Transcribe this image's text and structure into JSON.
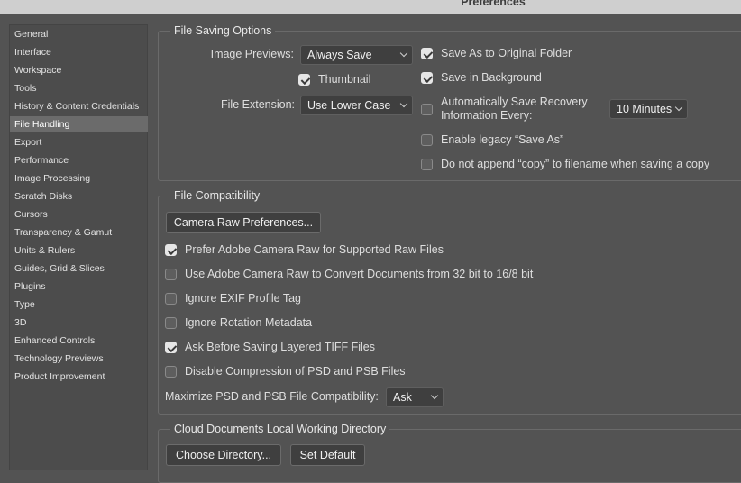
{
  "window": {
    "title": "Preferences"
  },
  "sidebar": {
    "items": [
      {
        "label": "General"
      },
      {
        "label": "Interface"
      },
      {
        "label": "Workspace"
      },
      {
        "label": "Tools"
      },
      {
        "label": "History & Content Credentials"
      },
      {
        "label": "File Handling",
        "selected": true
      },
      {
        "label": "Export"
      },
      {
        "label": "Performance"
      },
      {
        "label": "Image Processing"
      },
      {
        "label": "Scratch Disks"
      },
      {
        "label": "Cursors"
      },
      {
        "label": "Transparency & Gamut"
      },
      {
        "label": "Units & Rulers"
      },
      {
        "label": "Guides, Grid & Slices"
      },
      {
        "label": "Plugins"
      },
      {
        "label": "Type"
      },
      {
        "label": "3D"
      },
      {
        "label": "Enhanced Controls"
      },
      {
        "label": "Technology Previews"
      },
      {
        "label": "Product Improvement"
      }
    ]
  },
  "file_saving": {
    "title": "File Saving Options",
    "image_previews_label": "Image Previews:",
    "image_previews_value": "Always Save",
    "thumbnail_label": "Thumbnail",
    "thumbnail_checked": true,
    "file_extension_label": "File Extension:",
    "file_extension_value": "Use Lower Case",
    "save_as_original_label": "Save As to Original Folder",
    "save_as_original_checked": true,
    "save_background_label": "Save in Background",
    "save_background_checked": true,
    "auto_recovery_label_1": "Automatically Save Recovery",
    "auto_recovery_label_2": "Information Every:",
    "auto_recovery_checked": false,
    "auto_recovery_value": "10 Minutes",
    "legacy_save_as_label": "Enable legacy “Save As”",
    "legacy_save_as_checked": false,
    "no_copy_label": "Do not append “copy” to filename when saving a copy",
    "no_copy_checked": false
  },
  "compatibility": {
    "title": "File Compatibility",
    "camera_raw_button": "Camera Raw Preferences...",
    "options": [
      {
        "label": "Prefer Adobe Camera Raw for Supported Raw Files",
        "checked": true
      },
      {
        "label": "Use Adobe Camera Raw to Convert Documents from 32 bit to 16/8 bit",
        "checked": false
      },
      {
        "label": "Ignore EXIF Profile Tag",
        "checked": false
      },
      {
        "label": "Ignore Rotation Metadata",
        "checked": false
      },
      {
        "label": "Ask Before Saving Layered TIFF Files",
        "checked": true
      },
      {
        "label": "Disable Compression of PSD and PSB Files",
        "checked": false
      }
    ],
    "maximize_label": "Maximize PSD and PSB File Compatibility:",
    "maximize_value": "Ask"
  },
  "cloud": {
    "title": "Cloud Documents Local Working Directory",
    "choose_button": "Choose Directory...",
    "default_button": "Set Default"
  }
}
